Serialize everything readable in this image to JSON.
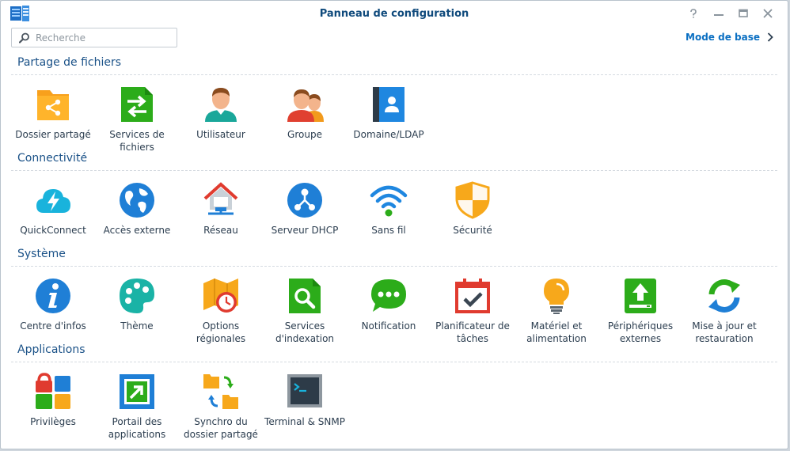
{
  "window": {
    "title": "Panneau de configuration"
  },
  "search": {
    "placeholder": "Recherche"
  },
  "mode_link": {
    "label": "Mode de base"
  },
  "sections": [
    {
      "title": "Partage de fichiers",
      "items": [
        {
          "label": "Dossier partagé",
          "icon": "shared-folder-icon"
        },
        {
          "label": "Services de fichiers",
          "icon": "file-services-icon"
        },
        {
          "label": "Utilisateur",
          "icon": "user-icon"
        },
        {
          "label": "Groupe",
          "icon": "group-icon"
        },
        {
          "label": "Domaine/LDAP",
          "icon": "domain-ldap-icon"
        }
      ]
    },
    {
      "title": "Connectivité",
      "items": [
        {
          "label": "QuickConnect",
          "icon": "quickconnect-icon"
        },
        {
          "label": "Accès externe",
          "icon": "external-access-icon"
        },
        {
          "label": "Réseau",
          "icon": "network-icon"
        },
        {
          "label": "Serveur DHCP",
          "icon": "dhcp-server-icon"
        },
        {
          "label": "Sans fil",
          "icon": "wireless-icon"
        },
        {
          "label": "Sécurité",
          "icon": "security-icon"
        }
      ]
    },
    {
      "title": "Système",
      "items": [
        {
          "label": "Centre d'infos",
          "icon": "info-center-icon"
        },
        {
          "label": "Thème",
          "icon": "theme-icon"
        },
        {
          "label": "Options régionales",
          "icon": "regional-options-icon"
        },
        {
          "label": "Services d'indexation",
          "icon": "indexing-service-icon"
        },
        {
          "label": "Notification",
          "icon": "notification-icon"
        },
        {
          "label": "Planificateur de tâches",
          "icon": "task-scheduler-icon"
        },
        {
          "label": "Matériel et alimentation",
          "icon": "hardware-power-icon"
        },
        {
          "label": "Périphériques externes",
          "icon": "external-devices-icon"
        },
        {
          "label": "Mise à jour et restauration",
          "icon": "update-restore-icon"
        }
      ]
    },
    {
      "title": "Applications",
      "items": [
        {
          "label": "Privilèges",
          "icon": "privileges-icon"
        },
        {
          "label": "Portail des applications",
          "icon": "application-portal-icon"
        },
        {
          "label": "Synchro du dossier partagé",
          "icon": "shared-folder-sync-icon"
        },
        {
          "label": "Terminal & SNMP",
          "icon": "terminal-snmp-icon"
        }
      ]
    }
  ]
}
